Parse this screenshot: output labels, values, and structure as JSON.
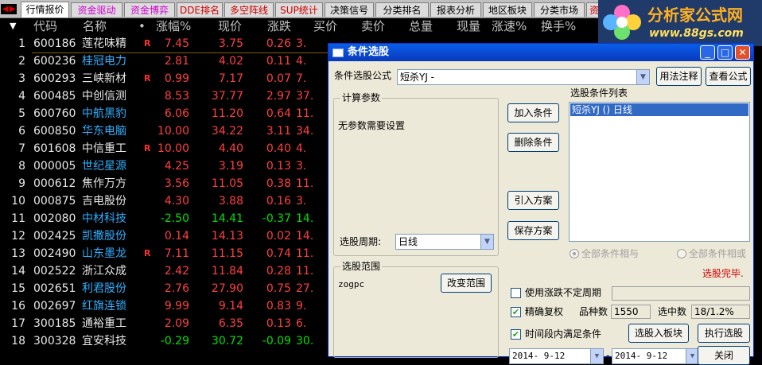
{
  "tabs": [
    {
      "label": "行情报价",
      "color": "#000000",
      "active": true
    },
    {
      "label": "资金驱动",
      "color": "#d000d0"
    },
    {
      "label": "资金博弈",
      "color": "#d000d0"
    },
    {
      "label": "DDE排名",
      "color": "#d00000"
    },
    {
      "label": "多空阵线",
      "color": "#d00000"
    },
    {
      "label": "SUP统计",
      "color": "#d00000"
    },
    {
      "label": "决策信号",
      "color": "#000000"
    },
    {
      "label": "分类排名",
      "color": "#000000"
    },
    {
      "label": "报表分析",
      "color": "#000000"
    },
    {
      "label": "地区板块",
      "color": "#000000"
    },
    {
      "label": "分类市场",
      "color": "#000000"
    },
    {
      "label": "资",
      "color": "#d00000"
    }
  ],
  "logo": {
    "name": "分析家公式网",
    "url": "www.88gs.com"
  },
  "columns": {
    "idx": "▼",
    "code": "代码",
    "name": "名称",
    "dot": "•",
    "pct": "涨幅%",
    "price": "现价",
    "chg": "涨跌",
    "buy": "买价",
    "sell": "卖价",
    "vol": "总量",
    "cur": "现量",
    "speed": "涨速%",
    "turnover": "换手%"
  },
  "rows": [
    {
      "n": "1",
      "code": "600186",
      "name": "莲花味精",
      "nc": "w",
      "r": "R",
      "pct": "7.45",
      "price": "3.75",
      "chg": "0.26",
      "buy": "3.",
      "c": "r"
    },
    {
      "n": "2",
      "code": "600236",
      "name": "桂冠电力",
      "nc": "c",
      "r": "",
      "pct": "2.81",
      "price": "4.02",
      "chg": "0.11",
      "buy": "4.",
      "c": "r"
    },
    {
      "n": "3",
      "code": "600293",
      "name": "三峡新材",
      "nc": "w",
      "r": "R",
      "pct": "0.99",
      "price": "7.17",
      "chg": "0.07",
      "buy": "7.",
      "c": "r"
    },
    {
      "n": "4",
      "code": "600485",
      "name": "中创信测",
      "nc": "w",
      "r": "",
      "pct": "8.53",
      "price": "37.77",
      "chg": "2.97",
      "buy": "37.",
      "c": "r"
    },
    {
      "n": "5",
      "code": "600760",
      "name": "中航黑豹",
      "nc": "c",
      "r": "",
      "pct": "6.06",
      "price": "11.20",
      "chg": "0.64",
      "buy": "11.",
      "c": "r"
    },
    {
      "n": "6",
      "code": "600850",
      "name": "华东电脑",
      "nc": "c",
      "r": "",
      "pct": "10.00",
      "price": "34.22",
      "chg": "3.11",
      "buy": "34.",
      "c": "r"
    },
    {
      "n": "7",
      "code": "601608",
      "name": "中信重工",
      "nc": "w",
      "r": "R",
      "pct": "10.00",
      "price": "4.40",
      "chg": "0.40",
      "buy": "4.",
      "c": "r"
    },
    {
      "n": "8",
      "code": "000005",
      "name": "世纪星源",
      "nc": "c",
      "r": "",
      "pct": "4.25",
      "price": "3.19",
      "chg": "0.13",
      "buy": "3.",
      "c": "r"
    },
    {
      "n": "9",
      "code": "000612",
      "name": "焦作万方",
      "nc": "w",
      "r": "",
      "pct": "3.56",
      "price": "11.05",
      "chg": "0.38",
      "buy": "11.",
      "c": "r"
    },
    {
      "n": "10",
      "code": "000875",
      "name": "吉电股份",
      "nc": "w",
      "r": "",
      "pct": "4.30",
      "price": "3.88",
      "chg": "0.16",
      "buy": "3.",
      "c": "r"
    },
    {
      "n": "11",
      "code": "002080",
      "name": "中材科技",
      "nc": "c",
      "r": "",
      "pct": "-2.50",
      "price": "14.41",
      "chg": "-0.37",
      "buy": "14.",
      "c": "g"
    },
    {
      "n": "12",
      "code": "002425",
      "name": "凯撒股份",
      "nc": "c",
      "r": "",
      "pct": "0.14",
      "price": "14.13",
      "chg": "0.02",
      "buy": "14.",
      "c": "r"
    },
    {
      "n": "13",
      "code": "002490",
      "name": "山东墨龙",
      "nc": "c",
      "r": "R",
      "pct": "7.11",
      "price": "11.15",
      "chg": "0.74",
      "buy": "11.",
      "c": "r"
    },
    {
      "n": "14",
      "code": "002522",
      "name": "浙江众成",
      "nc": "w",
      "r": "",
      "pct": "2.42",
      "price": "11.84",
      "chg": "0.28",
      "buy": "11.",
      "c": "r"
    },
    {
      "n": "15",
      "code": "002651",
      "name": "利君股份",
      "nc": "c",
      "r": "",
      "pct": "2.76",
      "price": "27.90",
      "chg": "0.75",
      "buy": "27.",
      "c": "r"
    },
    {
      "n": "16",
      "code": "002697",
      "name": "红旗连锁",
      "nc": "c",
      "r": "",
      "pct": "9.99",
      "price": "9.14",
      "chg": "0.83",
      "buy": "9.",
      "c": "r"
    },
    {
      "n": "17",
      "code": "300185",
      "name": "通裕重工",
      "nc": "w",
      "r": "",
      "pct": "2.09",
      "price": "6.35",
      "chg": "0.13",
      "buy": "6.",
      "c": "r"
    },
    {
      "n": "18",
      "code": "300328",
      "name": "宜安科技",
      "nc": "w",
      "r": "",
      "pct": "-0.29",
      "price": "30.72",
      "chg": "-0.09",
      "buy": "30.",
      "c": "g"
    }
  ],
  "colors": {
    "r": "#ff4040",
    "g": "#00e000",
    "w": "#e8e8e8",
    "c": "#30b0ff",
    "code": "#e8e8e8"
  },
  "dialog": {
    "title": "条件选股",
    "formula_label": "条件选股公式",
    "formula_value": "短杀YJ   -",
    "usage_btn": "用法注释",
    "view_btn": "查看公式",
    "params_title": "计算参数",
    "params_text": "无参数需要设置",
    "period_label": "选股周期:",
    "period_value": "日线",
    "add_btn": "加入条件",
    "del_btn": "删除条件",
    "import_btn": "引入方案",
    "save_btn": "保存方案",
    "list_title": "选股条件列表",
    "list_items": [
      "短杀YJ  () 日线"
    ],
    "radio_and": "全部条件相与",
    "radio_or": "全部条件相或",
    "range_title": "选股范围",
    "range_value": "zogpc",
    "change_range_btn": "改变范围",
    "status": "选股完毕.",
    "chk_period": "使用涨跌不定周期",
    "chk_exact": "精确复权",
    "count_label": "品种数",
    "count_value": "1550",
    "hit_label": "选中数",
    "hit_value": "18/1.2%",
    "chk_time": "时间段内满足条件",
    "to_block_btn": "选股入板块",
    "run_btn": "执行选股",
    "date_from": "2014- 9-12",
    "date_to": "2014- 9-12",
    "close_btn": "关闭"
  }
}
